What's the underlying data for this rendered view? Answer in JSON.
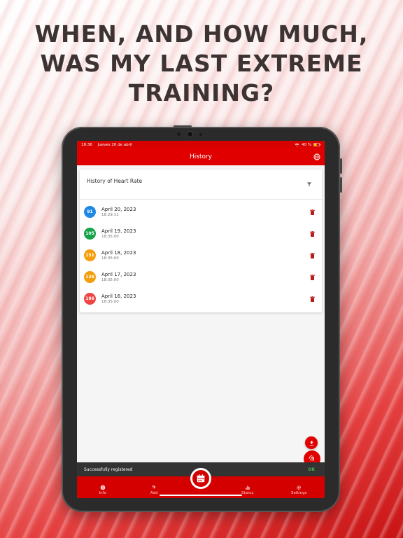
{
  "headline": [
    "WHEN, AND HOW MUCH,",
    "WAS MY LAST EXTREME",
    "TRAINING?"
  ],
  "status_bar": {
    "time": "18:36",
    "date": "Jueves 20 de abril",
    "battery": "40 %"
  },
  "app_bar": {
    "title": "History",
    "icon": "globe-icon"
  },
  "card": {
    "title": "History of Heart Rate",
    "filter_icon": "filter-icon"
  },
  "entries": [
    {
      "value": "91",
      "date": "April 20, 2023",
      "time": "18:29:11",
      "color": "#1e88e5"
    },
    {
      "value": "105",
      "date": "April 19, 2023",
      "time": "18:35:00",
      "color": "#16a34a"
    },
    {
      "value": "151",
      "date": "April 18, 2023",
      "time": "18:35:00",
      "color": "#f59e0b"
    },
    {
      "value": "136",
      "date": "April 17, 2023",
      "time": "18:35:00",
      "color": "#f59e0b"
    },
    {
      "value": "186",
      "date": "April 16, 2023",
      "time": "18:35:00",
      "color": "#ef4444"
    }
  ],
  "snackbar": {
    "message": "Successfully registered",
    "action": "OK"
  },
  "nav": {
    "items": [
      {
        "label": "Info",
        "icon": "info-icon"
      },
      {
        "label": "Add",
        "icon": "fingerprint-icon"
      },
      {
        "label": "Status",
        "icon": "bar-chart-icon"
      },
      {
        "label": "Settings",
        "icon": "gear-icon"
      }
    ],
    "center_icon": "calendar-icon"
  },
  "colors": {
    "primary": "#e00000",
    "snackbar": "#333333",
    "ok": "#4caf50"
  }
}
